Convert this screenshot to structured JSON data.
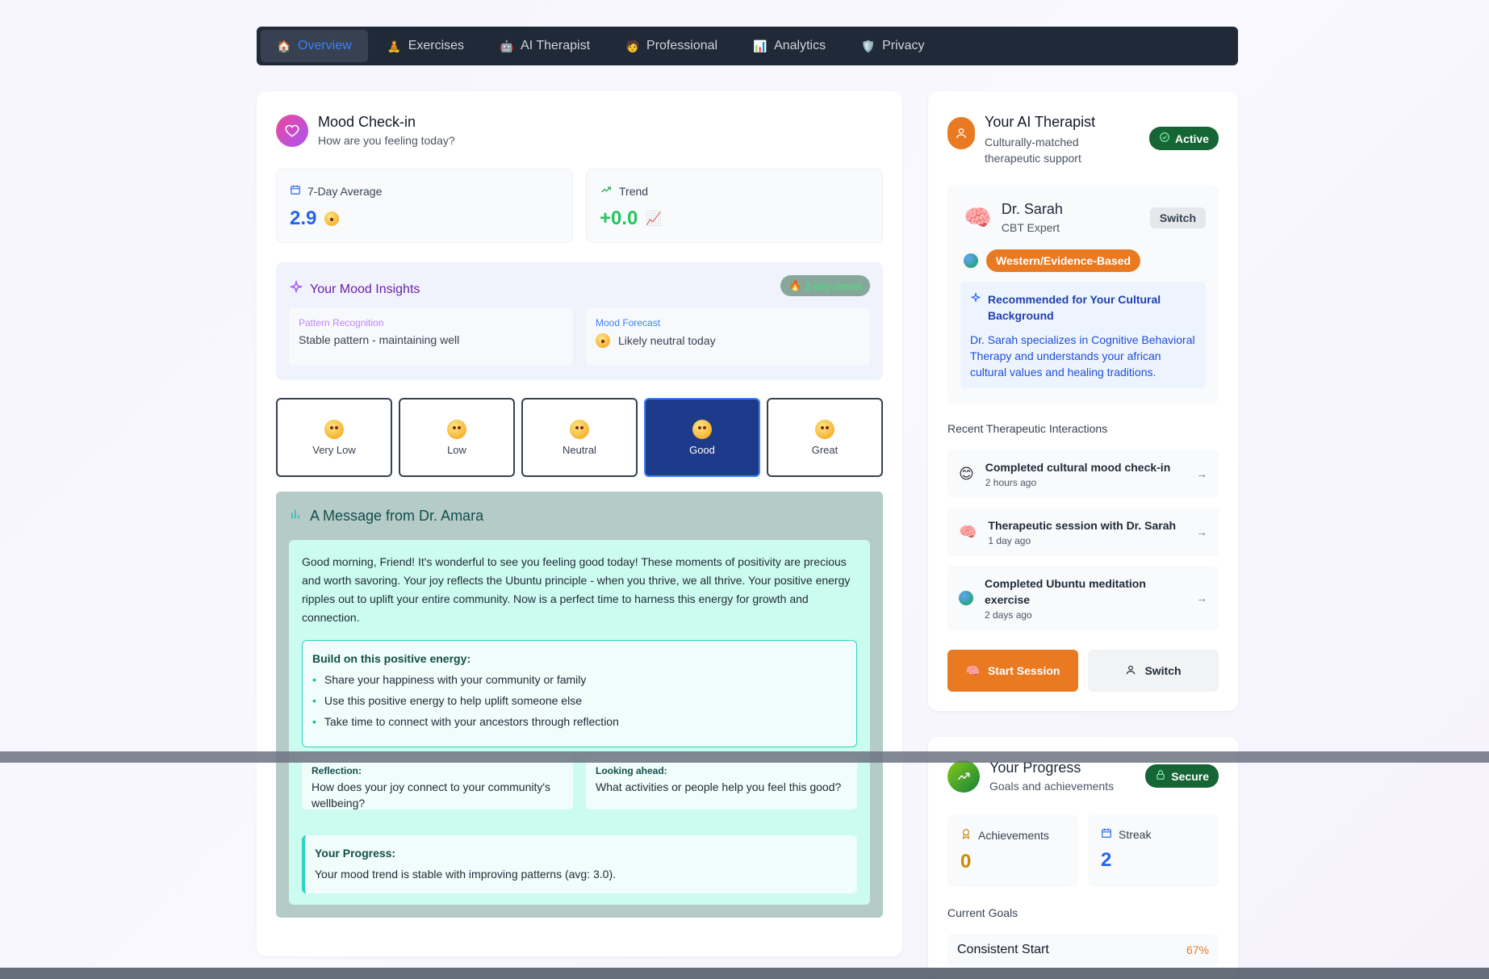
{
  "nav": {
    "tabs": [
      {
        "label": "Overview",
        "icon": "home-icon",
        "glyph": "🏠",
        "active": true
      },
      {
        "label": "Exercises",
        "icon": "meditation-icon",
        "glyph": "🧘",
        "active": false
      },
      {
        "label": "AI Therapist",
        "icon": "robot-icon",
        "glyph": "🤖",
        "active": false
      },
      {
        "label": "Professional",
        "icon": "person-icon",
        "glyph": "🧑",
        "active": false
      },
      {
        "label": "Analytics",
        "icon": "chart-icon",
        "glyph": "📊",
        "active": false
      },
      {
        "label": "Privacy",
        "icon": "shield-icon",
        "glyph": "🛡️",
        "active": false
      }
    ]
  },
  "mood": {
    "title": "Mood Check-in",
    "subtitle": "How are you feeling today?",
    "avg_label": "7-Day Average",
    "avg_value": "2.9",
    "trend_label": "Trend",
    "trend_value": "+0.0",
    "insights": {
      "title": "Your Mood Insights",
      "streak": "2 day streak",
      "pattern_label": "Pattern Recognition",
      "pattern_value": "Stable pattern - maintaining well",
      "forecast_label": "Mood Forecast",
      "forecast_value": "Likely neutral today"
    },
    "options": [
      "Very Low",
      "Low",
      "Neutral",
      "Good",
      "Great"
    ],
    "selected": "Good"
  },
  "message": {
    "title": "A Message from Dr. Amara",
    "body": "Good morning, Friend! It's wonderful to see you feeling good today! These moments of positivity are precious and worth savoring. Your joy reflects the Ubuntu principle - when you thrive, we all thrive. Your positive energy ripples out to uplift your entire community. Now is a perfect time to harness this energy for growth and connection.",
    "build_title": "Build on this positive energy:",
    "build_items": [
      "Share your happiness with your community or family",
      "Use this positive energy to help uplift someone else",
      "Take time to connect with your ancestors through reflection"
    ],
    "reflection_label": "Reflection:",
    "reflection_text": "How does your joy connect to your community's wellbeing?",
    "ahead_label": "Looking ahead:",
    "ahead_text": "What activities or people help you feel this good?",
    "progress_label": "Your Progress:",
    "progress_text": "Your mood trend is stable with improving patterns (avg: 3.0)."
  },
  "therapist": {
    "title": "Your AI Therapist",
    "subtitle": "Culturally-matched therapeutic support",
    "status": "Active",
    "name": "Dr. Sarah",
    "role": "CBT Expert",
    "switch_label": "Switch",
    "approach": "Western/Evidence-Based",
    "rec_title": "Recommended for Your Cultural Background",
    "rec_text": "Dr. Sarah specializes in Cognitive Behavioral Therapy and understands your african cultural values and healing traditions.",
    "recent_title": "Recent Therapeutic Interactions",
    "interactions": [
      {
        "title": "Completed cultural mood check-in",
        "time": "2 hours ago",
        "icon": "smile-icon"
      },
      {
        "title": "Therapeutic session with Dr. Sarah",
        "time": "1 day ago",
        "icon": "brain-icon"
      },
      {
        "title": "Completed Ubuntu meditation exercise",
        "time": "2 days ago",
        "icon": "globe-icon"
      }
    ],
    "start_label": "Start Session",
    "switch_btn_label": "Switch"
  },
  "progress": {
    "title": "Your Progress",
    "subtitle": "Goals and achievements",
    "status": "Secure",
    "achievements_label": "Achievements",
    "achievements_value": "0",
    "streak_label": "Streak",
    "streak_value": "2",
    "goals_title": "Current Goals",
    "goal_name": "Consistent Start",
    "goal_pct": "67%"
  },
  "colors": {
    "accent_blue": "#2563eb",
    "accent_orange": "#ea7a22",
    "success_green": "#166534",
    "nav_bg": "#1f2937"
  }
}
